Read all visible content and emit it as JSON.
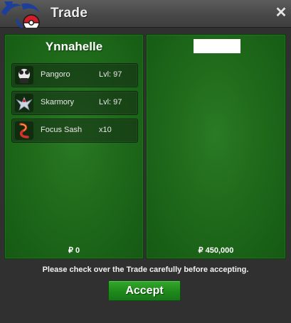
{
  "window": {
    "title": "Trade",
    "close_glyph": "✕"
  },
  "left_panel": {
    "trader_name": "Ynnahelle",
    "items": [
      {
        "name": "Pangoro",
        "qty": "Lvl: 97",
        "icon": "pangoro-icon"
      },
      {
        "name": "Skarmory",
        "qty": "Lvl: 97",
        "icon": "skarmory-icon"
      },
      {
        "name": "Focus Sash",
        "qty": "x10",
        "icon": "focus-sash-icon"
      }
    ],
    "money": "₽ 0"
  },
  "right_panel": {
    "trader_name": "",
    "items": [],
    "money": "₽ 450,000"
  },
  "notice": "Please check over the Trade carefully before accepting.",
  "accept_label": "Accept",
  "colors": {
    "panel_green": "#1f6a1b",
    "accept_green": "#1f8a1a",
    "titlebar": "#474747",
    "logo_blue": "#1d3f9c",
    "logo_red": "#d11e2b"
  }
}
